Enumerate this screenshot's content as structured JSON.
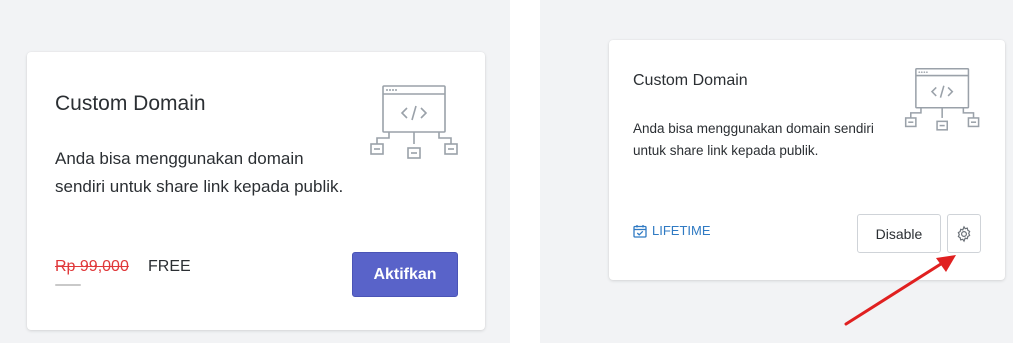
{
  "left_card": {
    "title": "Custom Domain",
    "description": "Anda bisa menggunakan domain sendiri untuk share link kepada publik.",
    "price_old": "Rp 99,000",
    "price_new": "FREE",
    "activate_label": "Aktifkan"
  },
  "right_card": {
    "title": "Custom Domain",
    "description": "Anda bisa menggunakan domain sendiri untuk share link kepada publik.",
    "lifetime_label": "LIFETIME",
    "disable_label": "Disable"
  },
  "icons": {
    "illustration": "code-window-network-icon",
    "lifetime": "calendar-check-icon",
    "settings": "gear-icon",
    "annotation": "red-arrow"
  },
  "colors": {
    "primary_button": "#5963c9",
    "price_old": "#e0383a",
    "lifetime": "#2f7ac3",
    "arrow": "#e02020",
    "background": "#f2f3f5"
  }
}
